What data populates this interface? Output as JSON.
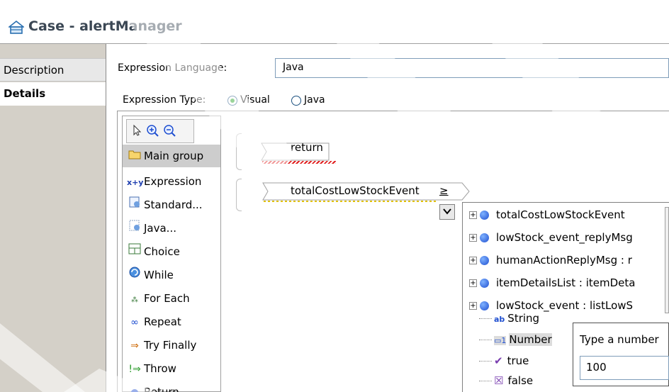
{
  "header": {
    "title": "Case - alertManager"
  },
  "tabs": [
    {
      "label": "Description"
    },
    {
      "label": "Details"
    }
  ],
  "form": {
    "expression_language_label": "Expression Language:",
    "expression_language_value": "Java",
    "expression_type_label": "Expression Type:",
    "visual_label": "Visual",
    "java_label": "Java",
    "selected_type": "Visual"
  },
  "palette": {
    "tools": [
      "select-arrow-icon",
      "zoom-in-icon",
      "zoom-out-icon"
    ],
    "items": [
      {
        "label": "Main group",
        "icon": "folder-icon"
      },
      {
        "label": "Expression",
        "icon": "x+y"
      },
      {
        "label": "Standard...",
        "icon": "standard-icon"
      },
      {
        "label": "Java...",
        "icon": "java-icon"
      },
      {
        "label": "Choice",
        "icon": "choice-icon"
      },
      {
        "label": "While",
        "icon": "while-icon"
      },
      {
        "label": "For Each",
        "icon": "for-each-icon"
      },
      {
        "label": "Repeat",
        "icon": "repeat-icon"
      },
      {
        "label": "Try Finally",
        "icon": "try-finally-icon"
      },
      {
        "label": "Throw",
        "icon": "throw-icon"
      },
      {
        "label": "Return",
        "icon": "return-icon"
      }
    ]
  },
  "canvas": {
    "return_label": "return",
    "expression_label": "totalCostLowStockEvent",
    "operator": "≥"
  },
  "dropdown": {
    "items": [
      {
        "label": "totalCostLowStockEvent",
        "type": "variable"
      },
      {
        "label": "lowStock_event_replyMsg",
        "type": "variable"
      },
      {
        "label": "humanActionReplyMsg : r",
        "type": "variable"
      },
      {
        "label": "itemDetailsList : itemDeta",
        "type": "variable"
      },
      {
        "label": "lowStock_event : listLowS",
        "type": "variable"
      },
      {
        "label": "String",
        "type": "literal"
      },
      {
        "label": "Number",
        "type": "literal"
      },
      {
        "label": "true",
        "type": "literal"
      },
      {
        "label": "false",
        "type": "literal"
      }
    ]
  },
  "popup": {
    "label": "Type a number",
    "value": "100"
  },
  "colors": {
    "accent_green": "#21a121",
    "header_text": "#3b4754",
    "tab_strip": "#d4d0c8"
  }
}
